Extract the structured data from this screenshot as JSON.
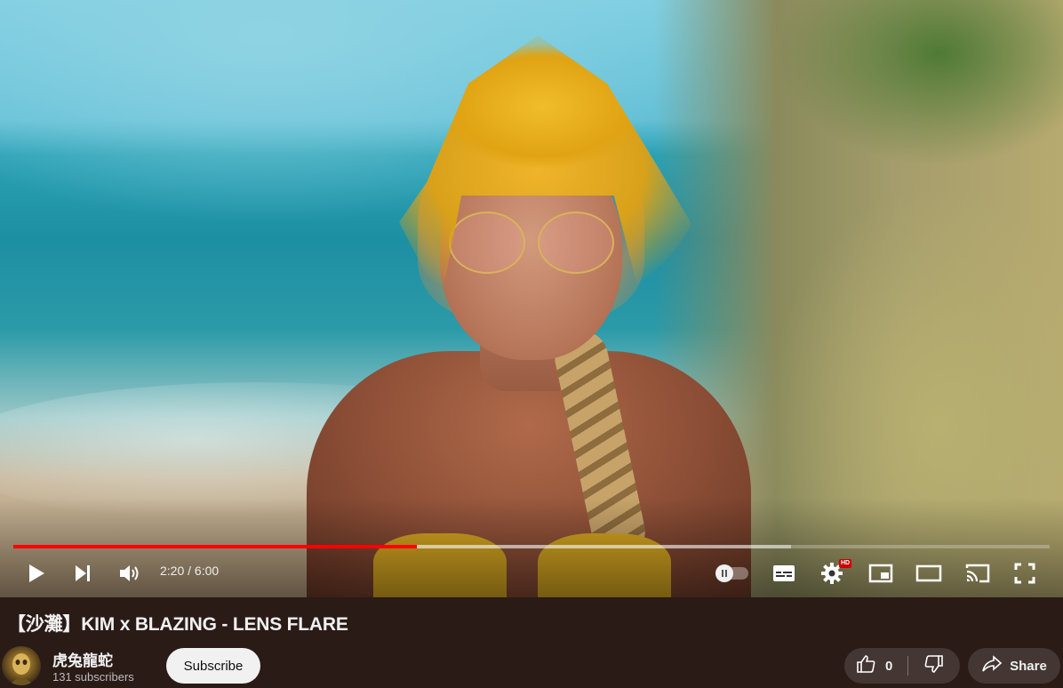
{
  "video": {
    "current_time": "2:20",
    "duration": "6:00",
    "time_display": "2:20 / 6:00",
    "played_fraction": 0.389,
    "buffered_fraction": 0.75,
    "quality_badge": "HD"
  },
  "controls": {
    "play_icon": "play-icon",
    "next_icon": "next-icon",
    "volume_icon": "volume-icon",
    "autoplay_icon": "autoplay-toggle-icon",
    "subtitles_icon": "subtitles-icon",
    "settings_icon": "gear-icon",
    "miniplayer_icon": "miniplayer-icon",
    "theater_icon": "theater-mode-icon",
    "cast_icon": "cast-icon",
    "fullscreen_icon": "fullscreen-icon"
  },
  "title": "【沙灘】KIM x BLAZING - LENS FLARE",
  "channel": {
    "name": "虎兔龍蛇",
    "subscribers": "131 subscribers"
  },
  "actions": {
    "subscribe_label": "Subscribe",
    "like_count": "0",
    "share_label": "Share"
  },
  "colors": {
    "progress_played": "#ff0000",
    "page_background": "#2a1b17",
    "subscribe_bg": "#f1f1f1"
  }
}
